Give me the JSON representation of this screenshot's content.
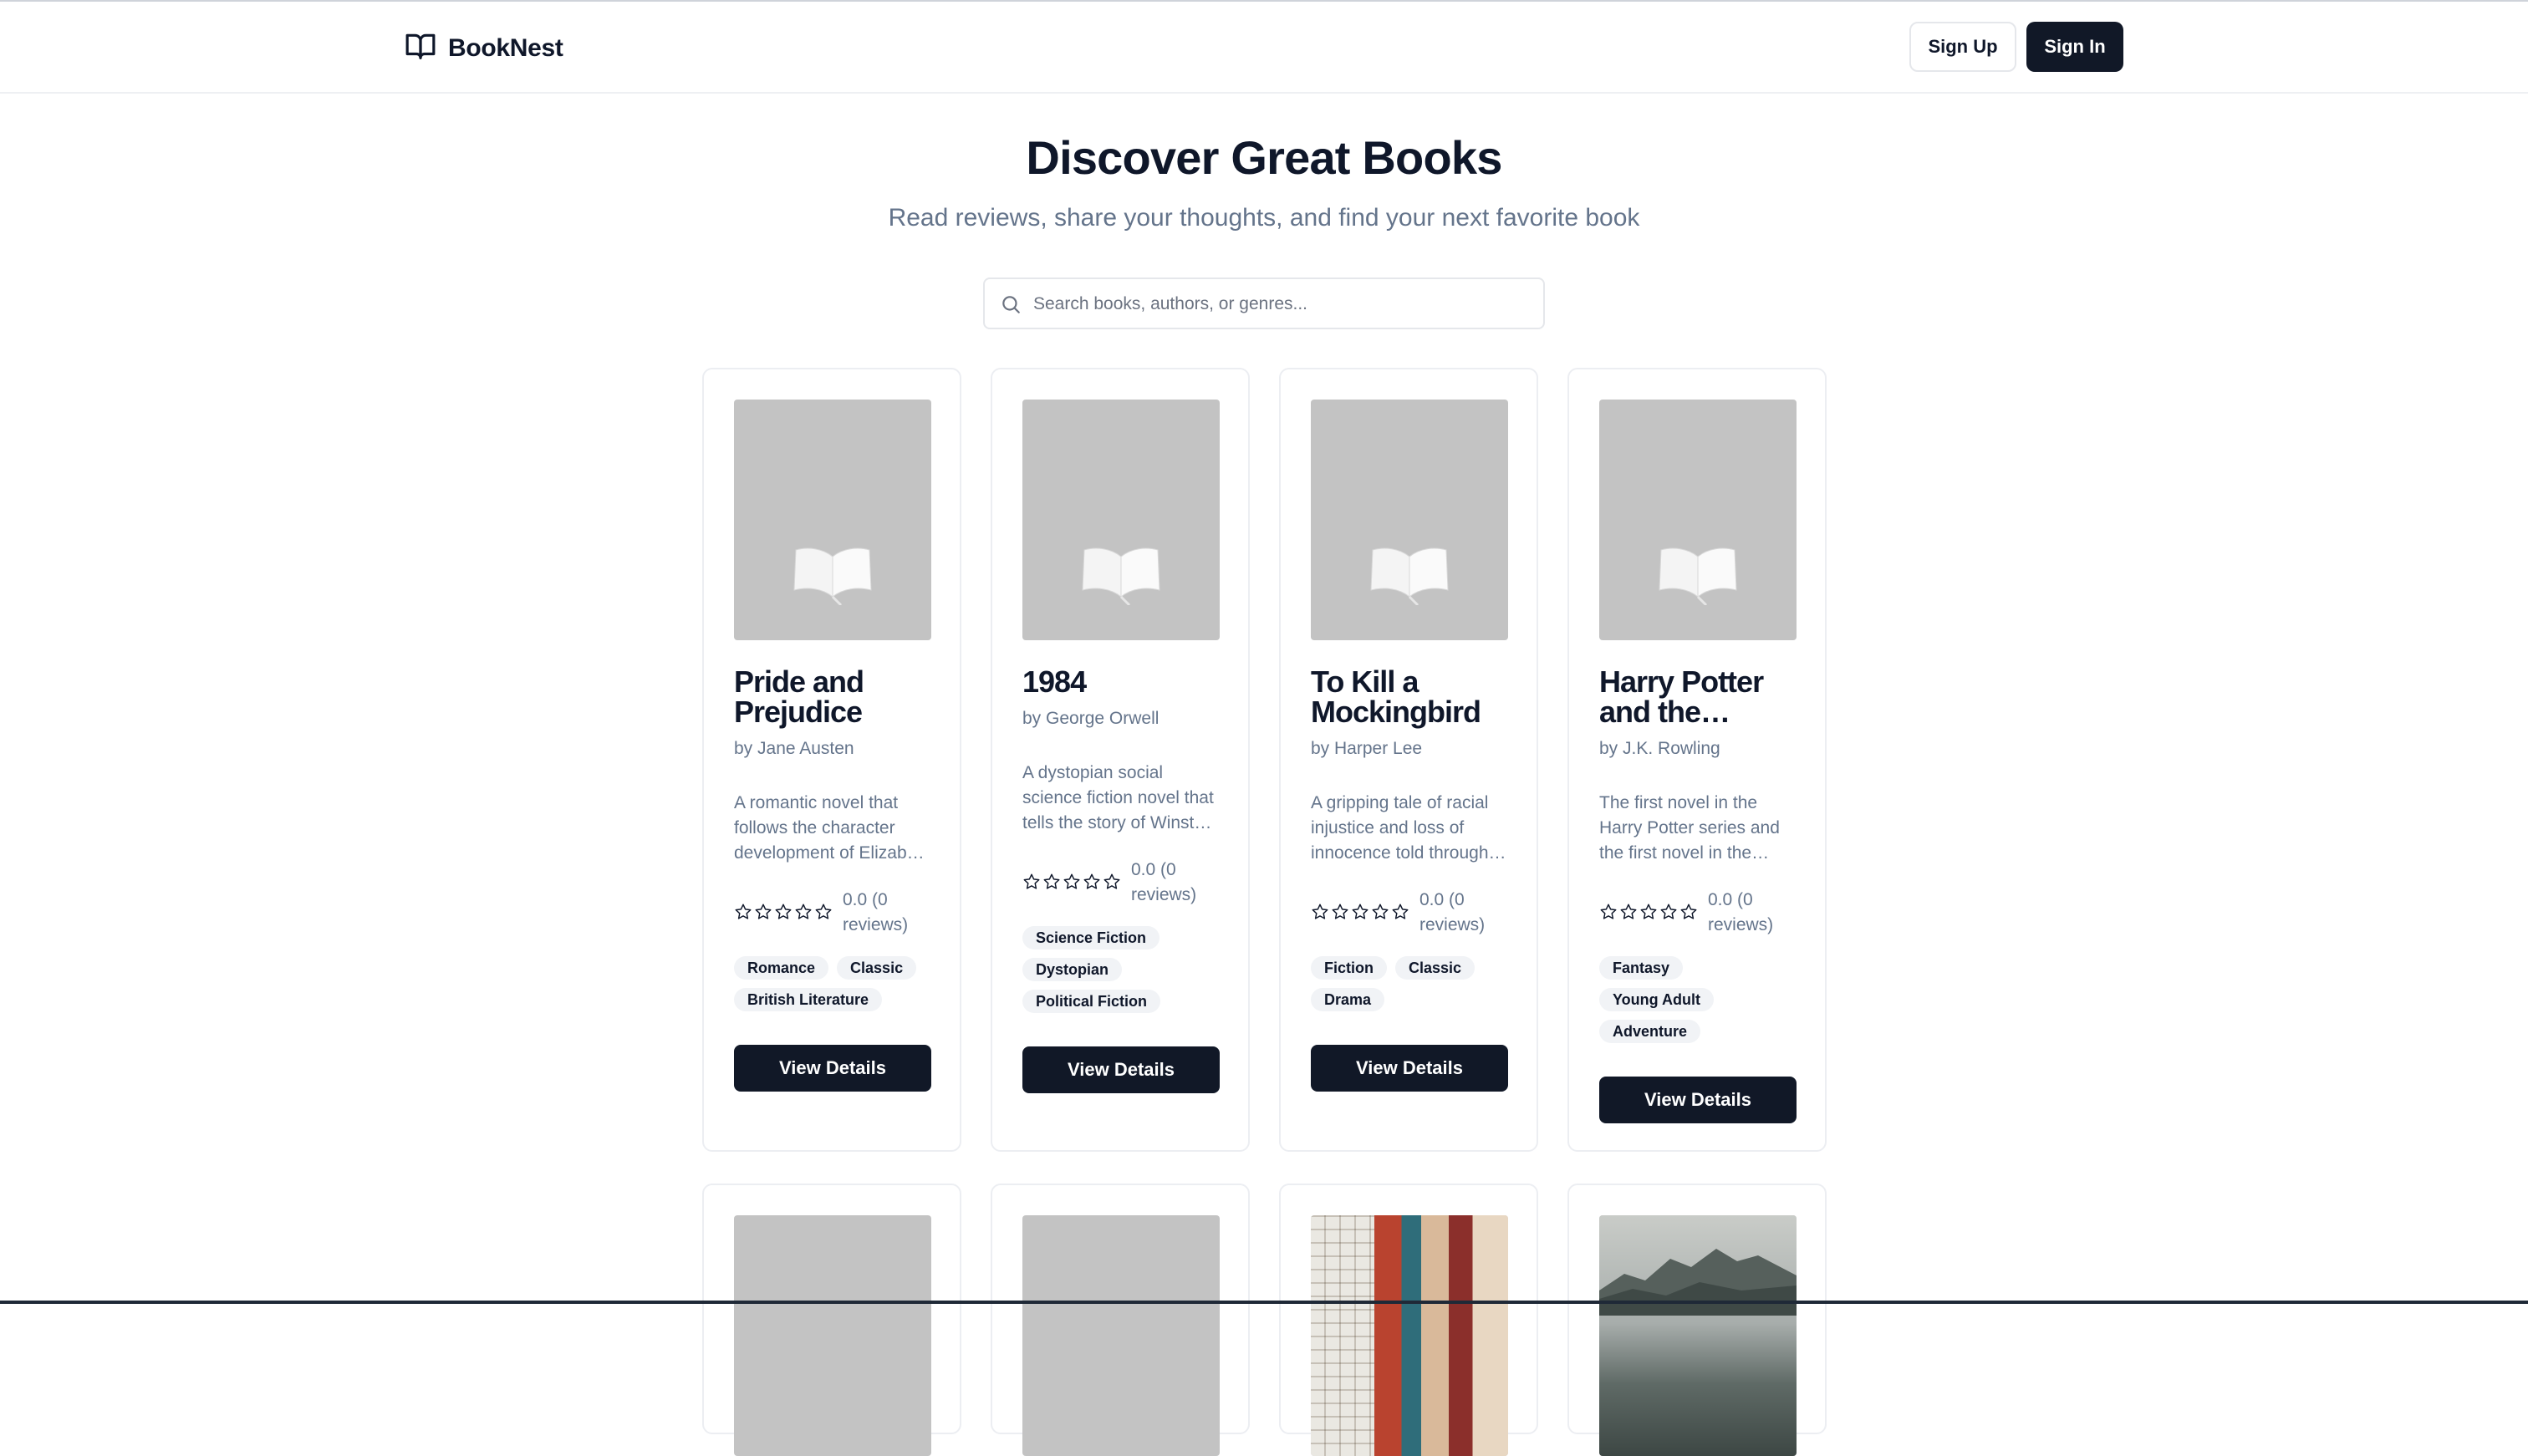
{
  "header": {
    "brand": "BookNest",
    "signup_label": "Sign Up",
    "signin_label": "Sign In"
  },
  "hero": {
    "title": "Discover Great Books",
    "subtitle": "Read reviews, share your thoughts, and find your next favorite book"
  },
  "search": {
    "placeholder": "Search books, authors, or genres..."
  },
  "books": [
    {
      "title": "Pride and Prejudice",
      "author": "by Jane Austen",
      "description": "A romantic novel that follows the character development of Elizabeth Bennet",
      "rating": "0.0 (0 reviews)",
      "tags": [
        "Romance",
        "Classic",
        "British Literature"
      ],
      "button": "View Details"
    },
    {
      "title": "1984",
      "author": "by George Orwell",
      "description": "A dystopian social science fiction novel that tells the story of Winston Smith",
      "rating": "0.0 (0 reviews)",
      "tags": [
        "Science Fiction",
        "Dystopian",
        "Political Fiction"
      ],
      "button": "View Details"
    },
    {
      "title": "To Kill a Mockingbird",
      "author": "by Harper Lee",
      "description": "A gripping tale of racial injustice and loss of innocence told through the eyes of a child",
      "rating": "0.0 (0 reviews)",
      "tags": [
        "Fiction",
        "Classic",
        "Drama"
      ],
      "button": "View Details"
    },
    {
      "title": "Harry Potter and the…",
      "author": "by J.K. Rowling",
      "description": "The first novel in the Harry Potter series and the first novel in the wizarding world",
      "rating": "0.0 (0 reviews)",
      "tags": [
        "Fantasy",
        "Young Adult",
        "Adventure"
      ],
      "button": "View Details"
    }
  ]
}
